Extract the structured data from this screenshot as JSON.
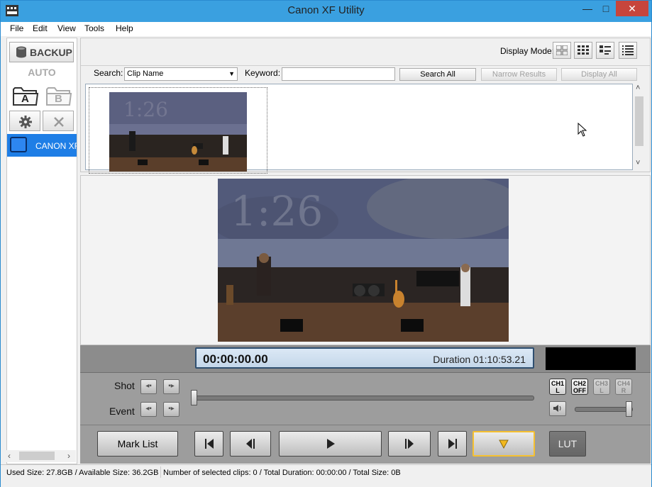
{
  "window": {
    "title": "Canon XF Utility",
    "minimize": "—",
    "maximize": "□",
    "close": "✕"
  },
  "menu": [
    "File",
    "Edit",
    "View",
    "Tools",
    "Help"
  ],
  "left_panel": {
    "backup_label": "BACKUP",
    "auto_label": "AUTO",
    "folder_a": "A",
    "folder_b": "B",
    "device_label": "CANON XF"
  },
  "toolbar": {
    "display_mode_label": "Display Mode:",
    "search_label": "Search:",
    "search_select_value": "Clip Name",
    "keyword_label": "Keyword:",
    "keyword_value": "",
    "search_all": "Search All",
    "narrow_results": "Narrow Results",
    "display_all": "Display All"
  },
  "thumbnail": {
    "overlay_text": "1:26"
  },
  "preview": {
    "overlay_text": "1:26"
  },
  "playback": {
    "timecode": "00:00:00.00",
    "duration": "Duration 01:10:53.21",
    "shot_label": "Shot",
    "event_label": "Event",
    "channels": [
      {
        "top": "CH1",
        "bottom": "L",
        "state": "on"
      },
      {
        "top": "CH2",
        "bottom": "OFF",
        "state": "on"
      },
      {
        "top": "CH3",
        "bottom": "L",
        "state": "off"
      },
      {
        "top": "CH4",
        "bottom": "R",
        "state": "off"
      }
    ],
    "mark_list": "Mark List",
    "lut": "LUT"
  },
  "status": {
    "sizes": "Used Size: 27.8GB / Available Size: 36.2GB",
    "selection": "Number of selected clips: 0 / Total Duration: 00:00:00 / Total Size: 0B"
  }
}
